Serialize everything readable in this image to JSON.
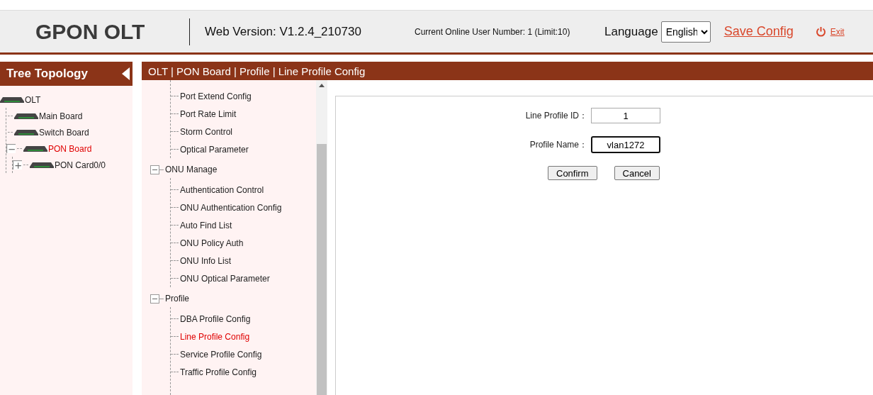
{
  "header": {
    "title": "GPON OLT",
    "version": "Web Version: V1.2.4_210730",
    "online_users": "Current Online User Number: 1 (Limit:10)",
    "language_label": "Language",
    "language": "English",
    "save_config": "Save Config",
    "exit": "Exit"
  },
  "sidebar": {
    "title": "Tree Topology",
    "tree": [
      {
        "label": "OLT",
        "selected": false,
        "children": [
          {
            "label": "Main Board",
            "selected": false
          },
          {
            "label": "Switch Board",
            "selected": false
          },
          {
            "label": "PON Board",
            "selected": true,
            "expanded": true,
            "children": [
              {
                "label": "PON Card0/0",
                "selected": false,
                "expanded": false
              }
            ]
          }
        ]
      }
    ]
  },
  "breadcrumb": "OLT | PON Board | Profile | Line Profile Config",
  "menu": [
    {
      "items": [
        {
          "label": "Port Extend Config",
          "selected": false
        },
        {
          "label": "Port Rate Limit",
          "selected": false
        },
        {
          "label": "Storm Control",
          "selected": false
        },
        {
          "label": "Optical Parameter",
          "selected": false
        }
      ]
    },
    {
      "label": "ONU Manage",
      "expanded": true,
      "items": [
        {
          "label": "Authentication Control",
          "selected": false
        },
        {
          "label": "ONU Authentication Config",
          "selected": false
        },
        {
          "label": "Auto Find List",
          "selected": false
        },
        {
          "label": "ONU Policy Auth",
          "selected": false
        },
        {
          "label": "ONU Info List",
          "selected": false
        },
        {
          "label": "ONU Optical Parameter",
          "selected": false
        }
      ]
    },
    {
      "label": "Profile",
      "expanded": true,
      "items": [
        {
          "label": "DBA Profile Config",
          "selected": false
        },
        {
          "label": "Line Profile Config",
          "selected": true
        },
        {
          "label": "Service Profile Config",
          "selected": false
        },
        {
          "label": "Traffic Profile Config",
          "selected": false
        }
      ]
    }
  ],
  "form": {
    "fields": [
      {
        "label": "Line Profile ID：",
        "value": "1",
        "focused": false
      },
      {
        "label": "Profile Name：",
        "value": "vlan1272",
        "focused": true
      }
    ],
    "buttons": [
      "Confirm",
      "Cancel"
    ]
  }
}
